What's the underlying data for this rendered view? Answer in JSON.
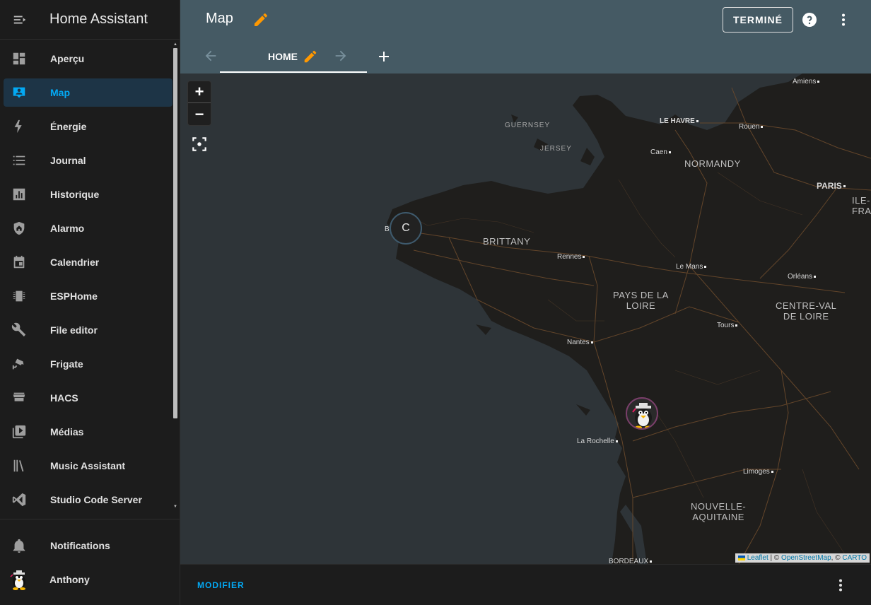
{
  "app": {
    "title": "Home Assistant"
  },
  "sidebar": {
    "items": [
      {
        "label": "Aperçu",
        "icon": "dashboard-icon",
        "active": false
      },
      {
        "label": "Map",
        "icon": "map-account-icon",
        "active": true
      },
      {
        "label": "Énergie",
        "icon": "lightning-icon",
        "active": false
      },
      {
        "label": "Journal",
        "icon": "list-icon",
        "active": false
      },
      {
        "label": "Historique",
        "icon": "chart-box-icon",
        "active": false
      },
      {
        "label": "Alarmo",
        "icon": "shield-home-icon",
        "active": false
      },
      {
        "label": "Calendrier",
        "icon": "calendar-icon",
        "active": false
      },
      {
        "label": "ESPHome",
        "icon": "chip-icon",
        "active": false
      },
      {
        "label": "File editor",
        "icon": "wrench-icon",
        "active": false
      },
      {
        "label": "Frigate",
        "icon": "cctv-icon",
        "active": false
      },
      {
        "label": "HACS",
        "icon": "hacs-store-icon",
        "active": false
      },
      {
        "label": "Médias",
        "icon": "play-box-multiple-icon",
        "active": false
      },
      {
        "label": "Music Assistant",
        "icon": "library-music-icon",
        "active": false
      },
      {
        "label": "Studio Code Server",
        "icon": "vscode-icon",
        "active": false
      }
    ],
    "notifications": "Notifications",
    "user": "Anthony"
  },
  "header": {
    "title": "Map",
    "done_label": "TERMINÉ",
    "tab_label": "HOME"
  },
  "map": {
    "cluster_label": "C",
    "cities": [
      "Amiens",
      "LE HAVRE",
      "Rouen",
      "Caen",
      "PARIS",
      "Rennes",
      "Le Mans",
      "Orléans",
      "Tours",
      "Nantes",
      "La Rochelle",
      "Limoges",
      "BORDEAUX"
    ],
    "regions": [
      "NORMANDY",
      "BRITTANY",
      "PAYS DE LA\nLOIRE",
      "CENTRE-VAL\nDE LOIRE",
      "NOUVELLE-\nAQUITAINE",
      "ILE-\nFRA"
    ],
    "islands": [
      "GUERNSEY",
      "JERSEY"
    ],
    "cluster_side_letter": "B",
    "attribution": {
      "leaflet": "Leaflet",
      "sep1": " | © ",
      "osm": "OpenStreetMap",
      "sep2": ", © ",
      "carto": "CARTO"
    },
    "colors": {
      "sea": "#2e3438",
      "land": "#1f1e1c",
      "roads": "#6b4a2c"
    }
  },
  "footer": {
    "modify_label": "MODIFIER"
  },
  "colors": {
    "accent": "#03a9f4",
    "header": "#455a64",
    "edit": "#ff9800"
  }
}
